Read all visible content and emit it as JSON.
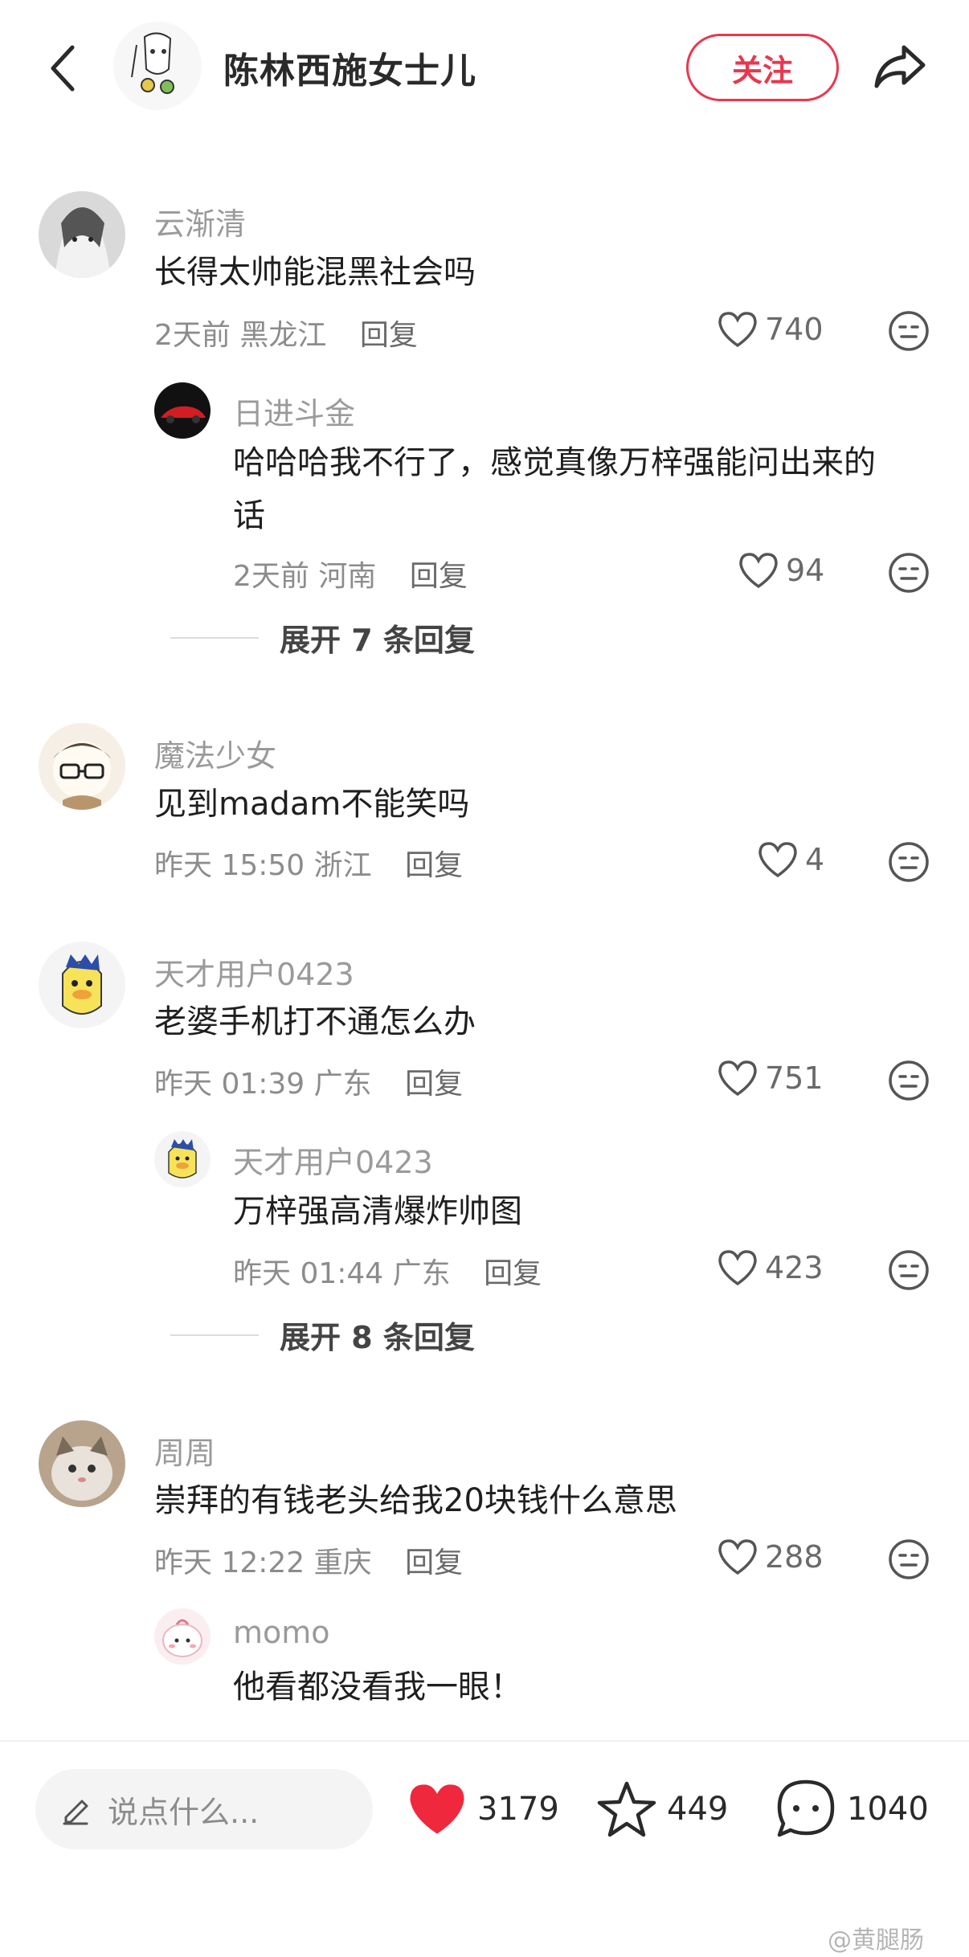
{
  "header": {
    "title": "陈林西施女士儿",
    "follow_label": "关注"
  },
  "comments": [
    {
      "user": "云渐清",
      "text": "长得太帅能混黑社会吗",
      "time": "2天前",
      "location": "黑龙江",
      "reply_label": "回复",
      "likes": "740"
    },
    {
      "user": "日进斗金",
      "text_line1": "哈哈哈我不行了，感觉真像万梓强能问出来的",
      "text_line2": "话",
      "time": "2天前",
      "location": "河南",
      "reply_label": "回复",
      "likes": "94",
      "expand_label": "展开 7 条回复"
    },
    {
      "user": "魔法少女",
      "text": "见到madam不能笑吗",
      "time": "昨天 15:50",
      "location": "浙江",
      "reply_label": "回复",
      "likes": "4"
    },
    {
      "user": "天才用户0423",
      "text": "老婆手机打不通怎么办",
      "time": "昨天 01:39",
      "location": "广东",
      "reply_label": "回复",
      "likes": "751"
    },
    {
      "user": "天才用户0423",
      "text": "万梓强高清爆炸帅图",
      "time": "昨天 01:44",
      "location": "广东",
      "reply_label": "回复",
      "likes": "423",
      "expand_label": "展开 8 条回复"
    },
    {
      "user": "周周",
      "text": "崇拜的有钱老头给我20块钱什么意思",
      "time": "昨天 12:22",
      "location": "重庆",
      "reply_label": "回复",
      "likes": "288"
    },
    {
      "user": "momo",
      "text": "他看都没看我一眼！"
    }
  ],
  "bottom": {
    "placeholder": "说点什么...",
    "likes": "3179",
    "favorites": "449",
    "comments": "1040"
  },
  "watermark": "@黄腿肠",
  "colors": {
    "accent": "#e8384f",
    "like_red": "#f0283d"
  }
}
